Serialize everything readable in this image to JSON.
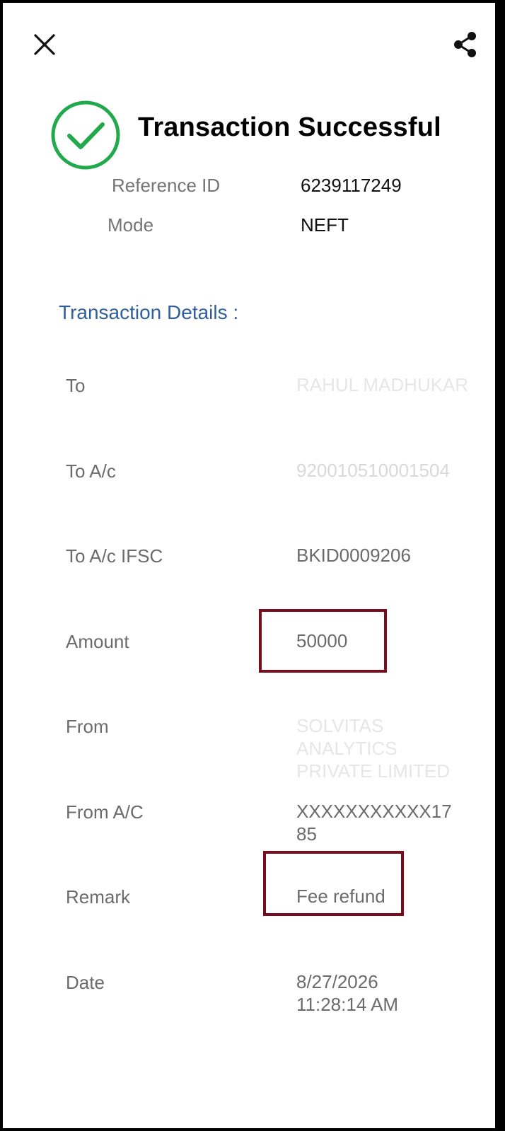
{
  "header": {
    "title": "Transaction Successful",
    "reference_label": "Reference ID",
    "reference_value": "6239117249",
    "mode_label": "Mode",
    "mode_value": "NEFT"
  },
  "section_title": "Transaction Details :",
  "details": {
    "to": {
      "label": "To",
      "value": "RAHUL MADHUKAR"
    },
    "to_ac": {
      "label": "To A/c",
      "value": "920010510001504"
    },
    "ifsc": {
      "label": "To A/c IFSC",
      "value": "BKID0009206"
    },
    "amount": {
      "label": "Amount",
      "value": "50000"
    },
    "from": {
      "label": "From",
      "value": "SOLVITAS ANALYTICS PRIVATE LIMITED"
    },
    "from_ac": {
      "label": "From A/C",
      "value": "XXXXXXXXXXX1785"
    },
    "remark": {
      "label": "Remark",
      "value": "Fee refund"
    },
    "date": {
      "label": "Date",
      "value": "8/27/2026 11:28:14 AM"
    }
  },
  "icons": {
    "close": "close-icon",
    "share": "share-icon",
    "success": "check-circle-icon"
  },
  "colors": {
    "success_green": "#22a94b",
    "section_blue": "#2f5f9c",
    "highlight_border": "#7a0c1f"
  }
}
